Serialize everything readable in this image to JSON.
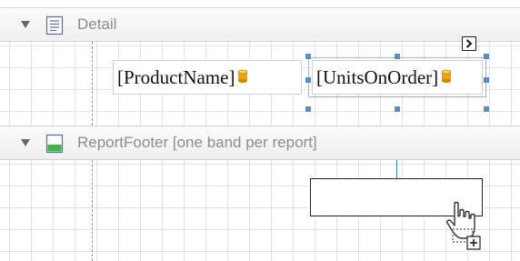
{
  "detail_band": {
    "title": "Detail",
    "label_product_name": "[ProductName]",
    "label_units_on_order": "[UnitsOnOrder]"
  },
  "report_footer_band": {
    "title": "ReportFooter [one band per report]"
  },
  "colors": {
    "handle": "#5a8cc6",
    "guide_line": "#0095d8",
    "database_icon": "#e8a317",
    "footer_icon": "#3fb549"
  },
  "icons": {
    "collapse": "triangle-down-icon",
    "detail_band": "detail-band-icon",
    "report_footer_band": "report-footer-band-icon",
    "field_binding": "database-icon",
    "smart_tag": "smart-tag-arrow-icon",
    "cursor": "drag-add-cursor-icon"
  }
}
